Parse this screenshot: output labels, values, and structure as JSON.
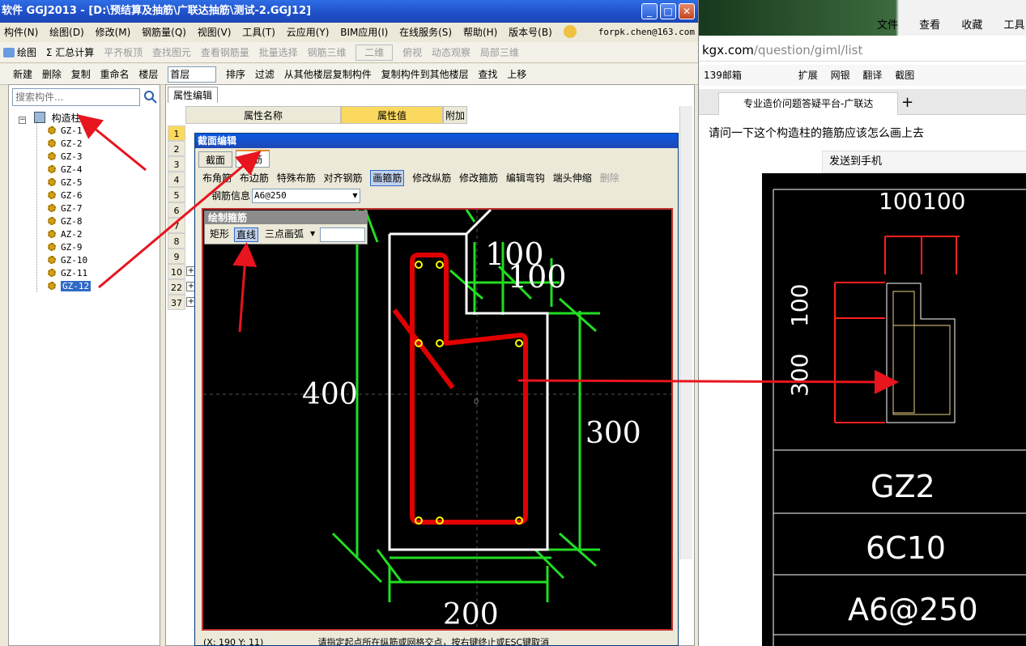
{
  "app": {
    "title": "软件 GGJ2013 - [D:\\预结算及抽筋\\广联达抽筋\\测试-2.GGJ12]",
    "menu": [
      "构件(N)",
      "绘图(D)",
      "修改(M)",
      "钢筋量(Q)",
      "视图(V)",
      "工具(T)",
      "云应用(Y)",
      "BIM应用(I)",
      "在线服务(S)",
      "帮助(H)",
      "版本号(B)"
    ],
    "account": "forpk.chen@163.com",
    "toolbar1": [
      {
        "label": "绘图",
        "enabled": true
      },
      {
        "label": "Σ 汇总计算",
        "enabled": true
      },
      {
        "label": "平齐板顶",
        "enabled": false
      },
      {
        "label": "查找图元",
        "enabled": false
      },
      {
        "label": "查看钢筋量",
        "enabled": false
      },
      {
        "label": "批量选择",
        "enabled": false
      },
      {
        "label": "钢筋三维",
        "enabled": false
      },
      {
        "label": "二维",
        "enabled": false
      },
      {
        "label": "俯视",
        "enabled": false
      },
      {
        "label": "动态观察",
        "enabled": false
      },
      {
        "label": "局部三维",
        "enabled": false
      }
    ],
    "toolbar2": [
      "新建",
      "删除",
      "复制",
      "重命名",
      "楼层",
      "首层",
      "排序",
      "过滤",
      "从其他楼层复制构件",
      "复制构件到其他楼层",
      "查找",
      "上移"
    ],
    "search_placeholder": "搜索构件...",
    "tree": {
      "root": "构造柱",
      "items": [
        "GZ-1",
        "GZ-2",
        "GZ-3",
        "GZ-4",
        "GZ-5",
        "GZ-6",
        "GZ-7",
        "GZ-8",
        "AZ-2",
        "GZ-9",
        "GZ-10",
        "GZ-11",
        "GZ-12"
      ],
      "selected": "GZ-12"
    },
    "property_panel": {
      "tab": "属性编辑",
      "headers": [
        "属性名称",
        "属性值",
        "附加"
      ],
      "row_numbers": [
        "1",
        "2",
        "3",
        "4",
        "5",
        "6",
        "7",
        "8",
        "9",
        "10",
        "22",
        "37"
      ]
    },
    "dialog": {
      "title": "截面编辑",
      "tabs": [
        "截面",
        "配筋"
      ],
      "active_tab": "配筋",
      "tools": [
        {
          "label": "布角筋",
          "state": "normal"
        },
        {
          "label": "布边筋",
          "state": "normal"
        },
        {
          "label": "特殊布筋",
          "state": "normal"
        },
        {
          "label": "对齐钢筋",
          "state": "normal"
        },
        {
          "label": "画箍筋",
          "state": "pressed"
        },
        {
          "label": "修改纵筋",
          "state": "normal"
        },
        {
          "label": "修改箍筋",
          "state": "normal"
        },
        {
          "label": "编辑弯钩",
          "state": "normal"
        },
        {
          "label": "端头伸缩",
          "state": "normal"
        },
        {
          "label": "删除",
          "state": "disabled"
        }
      ],
      "rebar_info_label": "钢筋信息",
      "rebar_info_value": "A6@250",
      "status_coord": "(X: 190 Y: 11)",
      "status_hint": "请指定起点所在纵筋或网格交点，按右键终止或ESC键取消"
    },
    "stirrup_panel": {
      "title": "绘制箍筋",
      "buttons": [
        "矩形",
        "直线",
        "三点画弧"
      ],
      "pressed": "直线"
    },
    "drawing": {
      "dim_top_1": "100",
      "dim_top_2": "100",
      "dim_left": "400",
      "dim_right": "300",
      "dim_bottom": "200",
      "origin": "0"
    }
  },
  "browser": {
    "menu": [
      "文件",
      "查看",
      "收藏",
      "工具"
    ],
    "address_host": "kgx.com",
    "address_path": "/question/giml/list",
    "favorites": [
      "139邮箱",
      "扩展",
      "网银",
      "翻译",
      "截图"
    ],
    "tab_title": "专业造价问题答疑平台-广联达",
    "question": "请问一下这个构造柱的箍筋应该怎么画上去",
    "send_to_phone": "发送到手机",
    "cad": {
      "dim_top_1": "100",
      "dim_top_2": "100",
      "dim_left_1": "100",
      "dim_left_2": "300",
      "name": "GZ2",
      "main_rebar": "6C10",
      "stirrup": "A6@250"
    }
  },
  "colors": {
    "rebar": "#e00000",
    "dimension": "#22dd22",
    "arrow": "#e8141e",
    "outline": "#ffffff",
    "cad_bg": "#000000"
  }
}
